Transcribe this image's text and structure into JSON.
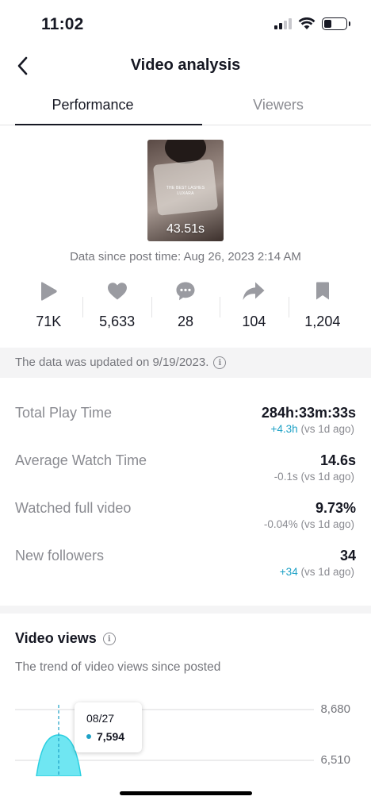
{
  "status_bar": {
    "time": "11:02",
    "battery_level": 0.35
  },
  "header": {
    "title": "Video analysis",
    "back_icon": "chevron-left-icon"
  },
  "tabs": [
    {
      "label": "Performance",
      "active": true
    },
    {
      "label": "Viewers",
      "active": false
    }
  ],
  "video": {
    "caption_line1": "THE BEST LASHES",
    "caption_line2": "LUXARA",
    "duration": "43.51s",
    "post_time_text": "Data since post time: Aug 26, 2023 2:14 AM"
  },
  "metrics": [
    {
      "icon": "play-icon",
      "value": "71K"
    },
    {
      "icon": "heart-icon",
      "value": "5,633"
    },
    {
      "icon": "comment-icon",
      "value": "28"
    },
    {
      "icon": "share-icon",
      "value": "104"
    },
    {
      "icon": "bookmark-icon",
      "value": "1,204"
    }
  ],
  "update_notice": "The data was updated on 9/19/2023.",
  "stats": [
    {
      "label": "Total Play Time",
      "value": "284h:33m:33s",
      "delta": "+4.3h",
      "delta_suffix": " (vs 1d ago)",
      "delta_positive": true
    },
    {
      "label": "Average Watch Time",
      "value": "14.6s",
      "delta": "-0.1s",
      "delta_suffix": " (vs 1d ago)",
      "delta_positive": false
    },
    {
      "label": "Watched full video",
      "value": "9.73%",
      "delta": "-0.04%",
      "delta_suffix": " (vs 1d ago)",
      "delta_positive": false
    },
    {
      "label": "New followers",
      "value": "34",
      "delta": "+34",
      "delta_suffix": " (vs 1d ago)",
      "delta_positive": true
    }
  ],
  "video_views": {
    "title": "Video views",
    "subtitle": "The trend of video views since posted",
    "tooltip": {
      "date": "08/27",
      "value": "7,594"
    }
  },
  "colors": {
    "accent": "#1da1c6",
    "area_fill": "#6fe6f2",
    "text": "#161823",
    "muted": "#8a8b91"
  },
  "chart_data": {
    "type": "area",
    "x": [
      "08/27"
    ],
    "series": [
      {
        "values": [
          7594
        ]
      }
    ],
    "y_ticks": [
      "8,680",
      "6,510"
    ],
    "highlight": {
      "x": "08/27",
      "value": 7594
    }
  }
}
